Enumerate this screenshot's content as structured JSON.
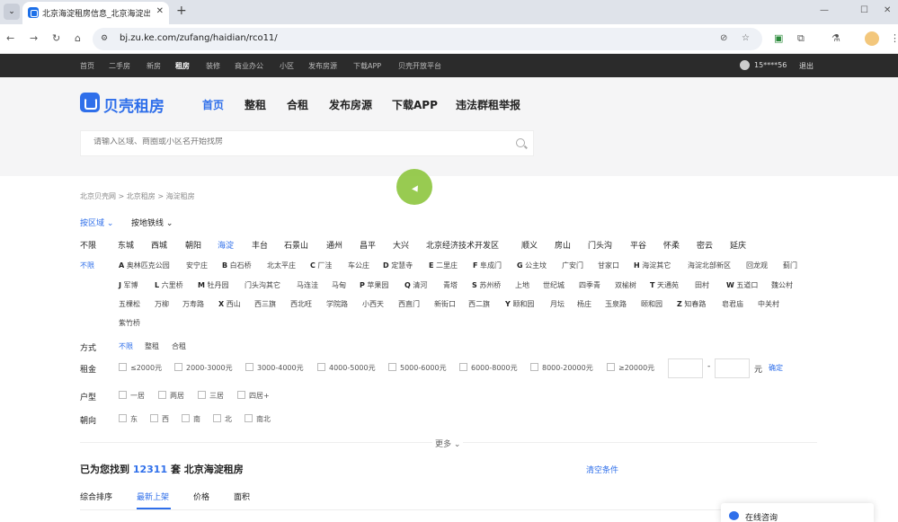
{
  "browser": {
    "tab_title": "北京海淀租房信息_北京海淀出租",
    "tab_close": "✕",
    "tab_menu": "⌄",
    "new_tab": "+",
    "win_min": "—",
    "win_max": "☐",
    "win_close": "✕",
    "back": "←",
    "forward": "→",
    "reload": "↻",
    "home": "⌂",
    "site_icon": "⚙",
    "url": "bj.zu.ke.com/zufang/haidian/rco11/",
    "eye_off": "⊘",
    "star": "☆",
    "ext1": "▣",
    "ext2": "⧉",
    "ext3": "⚗",
    "menu": "⋮"
  },
  "sitebar": {
    "links": [
      "首页",
      "二手房",
      "新房",
      "租房",
      "装修",
      "商业办公",
      "小区",
      "发布房源",
      "下载APP",
      "贝壳开放平台"
    ],
    "active_index": 3,
    "user": "15****56",
    "logout": "退出"
  },
  "header": {
    "logo": "贝壳租房",
    "nav": [
      "首页",
      "整租",
      "合租",
      "发布房源",
      "下载APP",
      "违法群租举报"
    ],
    "search_placeholder": "请输入区域、商圈或小区名开始找房"
  },
  "filters": {
    "breadcrumb": "北京贝壳网 > 北京租房 > 海淀租房",
    "tab_area": "按区域 ⌄",
    "tab_subway": "按地铁线 ⌄",
    "districts": [
      "不限",
      "东城",
      "西城",
      "朝阳",
      "海淀",
      "丰台",
      "石景山",
      "通州",
      "昌平",
      "大兴",
      "北京经济技术开发区",
      "顺义",
      "房山",
      "门头沟",
      "平谷",
      "怀柔",
      "密云",
      "延庆"
    ],
    "sub_none": "不限",
    "sub_row1": [
      {
        "k": "A",
        "t": "奥林匹克公园"
      },
      {
        "k": "",
        "t": "安宁庄"
      },
      {
        "k": "B",
        "t": "白石桥"
      },
      {
        "k": "",
        "t": "北太平庄"
      },
      {
        "k": "C",
        "t": "厂洼"
      },
      {
        "k": "",
        "t": "车公庄"
      },
      {
        "k": "D",
        "t": "定慧寺"
      },
      {
        "k": "E",
        "t": "二里庄"
      },
      {
        "k": "F",
        "t": "阜成门"
      },
      {
        "k": "G",
        "t": "公主坟"
      },
      {
        "k": "",
        "t": "广安门"
      },
      {
        "k": "",
        "t": "甘家口"
      },
      {
        "k": "H",
        "t": "海淀其它"
      },
      {
        "k": "",
        "t": "海淀北部新区"
      },
      {
        "k": "",
        "t": "回龙观"
      },
      {
        "k": "",
        "t": "蓟门"
      }
    ],
    "sub_row2": [
      {
        "k": "J",
        "t": "军博"
      },
      {
        "k": "L",
        "t": "六里桥"
      },
      {
        "k": "M",
        "t": "牡丹园"
      },
      {
        "k": "",
        "t": "门头沟其它"
      },
      {
        "k": "",
        "t": "马连洼"
      },
      {
        "k": "",
        "t": "马甸"
      },
      {
        "k": "P",
        "t": "苹果园"
      },
      {
        "k": "Q",
        "t": "清河"
      },
      {
        "k": "",
        "t": "青塔"
      },
      {
        "k": "S",
        "t": "苏州桥"
      },
      {
        "k": "",
        "t": "上地"
      },
      {
        "k": "",
        "t": "世纪城"
      },
      {
        "k": "",
        "t": "四季青"
      },
      {
        "k": "",
        "t": "双榆树"
      },
      {
        "k": "T",
        "t": "天通苑"
      },
      {
        "k": "",
        "t": "田村"
      },
      {
        "k": "W",
        "t": "五道口"
      },
      {
        "k": "",
        "t": "魏公村"
      }
    ],
    "sub_row3": [
      {
        "k": "",
        "t": "五棵松"
      },
      {
        "k": "",
        "t": "万柳"
      },
      {
        "k": "",
        "t": "万寿路"
      },
      {
        "k": "X",
        "t": "西山"
      },
      {
        "k": "",
        "t": "西三旗"
      },
      {
        "k": "",
        "t": "西北旺"
      },
      {
        "k": "",
        "t": "学院路"
      },
      {
        "k": "",
        "t": "小西天"
      },
      {
        "k": "",
        "t": "西直门"
      },
      {
        "k": "",
        "t": "新街口"
      },
      {
        "k": "",
        "t": "西二旗"
      },
      {
        "k": "Y",
        "t": "颐和园"
      },
      {
        "k": "",
        "t": "月坛"
      },
      {
        "k": "",
        "t": "杨庄"
      },
      {
        "k": "",
        "t": "玉泉路"
      },
      {
        "k": "",
        "t": "颐和园"
      },
      {
        "k": "Z",
        "t": "知春路"
      },
      {
        "k": "",
        "t": "皂君庙"
      },
      {
        "k": "",
        "t": "中关村"
      }
    ],
    "sub_row4": [
      {
        "k": "",
        "t": "紫竹桥"
      }
    ],
    "label_mode": "方式",
    "modes": [
      "不限",
      "整租",
      "合租"
    ],
    "label_rent": "租金",
    "rents": [
      "≤2000元",
      "2000-3000元",
      "3000-4000元",
      "4000-5000元",
      "5000-6000元",
      "6000-8000元",
      "8000-20000元",
      "≥20000元"
    ],
    "dash": "-",
    "yuan": "元",
    "confirm": "确定",
    "label_layout": "户型",
    "layouts": [
      "一居",
      "两居",
      "三居",
      "四居+"
    ],
    "label_orient": "朝向",
    "orients": [
      "东",
      "西",
      "南",
      "北",
      "南北"
    ],
    "more": "更多 ⌄"
  },
  "results": {
    "prefix": "已为您找到 ",
    "count": "12311",
    "suffix": " 套 北京海淀租房",
    "clear": "清空条件",
    "sorts": [
      "综合排序",
      "最新上架",
      "价格",
      "面积"
    ],
    "active_sort": 1
  },
  "consult": {
    "label": "在线咨询"
  },
  "colors": {
    "accent": "#2f6fea",
    "sitebar_bg": "#2b2b2b",
    "cursor": "#8dc63f"
  }
}
